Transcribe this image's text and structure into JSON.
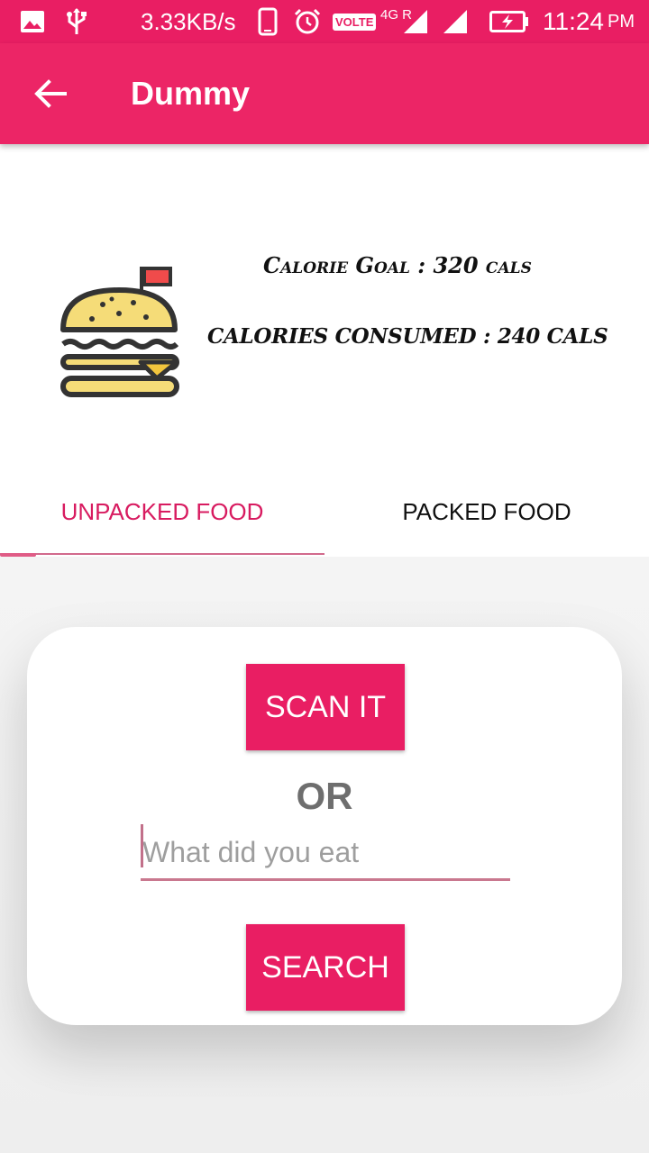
{
  "status_bar": {
    "speed": "3.33KB/s",
    "volte": "VOLTE",
    "network": "4G R",
    "time": "11:24",
    "ampm": "PM",
    "icons": [
      "image-icon",
      "usb-icon",
      "phone-icon",
      "alarm-icon",
      "signal-icon",
      "signal-icon",
      "battery-charging-icon"
    ]
  },
  "app_bar": {
    "title": "Dummy",
    "back_icon": "back-arrow-icon"
  },
  "header": {
    "image": "burger-icon",
    "calorie_goal": "Calorie Goal : 320 cals",
    "calories_consumed": "CALORIES CONSUMED : 240 CALS"
  },
  "tabs": {
    "items": [
      {
        "label": "UNPACKED FOOD",
        "selected": true
      },
      {
        "label": "PACKED FOOD",
        "selected": false
      }
    ]
  },
  "card": {
    "scan_label": "SCAN IT",
    "or_label": "OR",
    "input_placeholder": "What did you eat",
    "input_value": "",
    "search_label": "SEARCH"
  },
  "colors": {
    "primary": "#e91e63",
    "accent_text": "#d81b60",
    "or_text": "#6e6e6e"
  }
}
